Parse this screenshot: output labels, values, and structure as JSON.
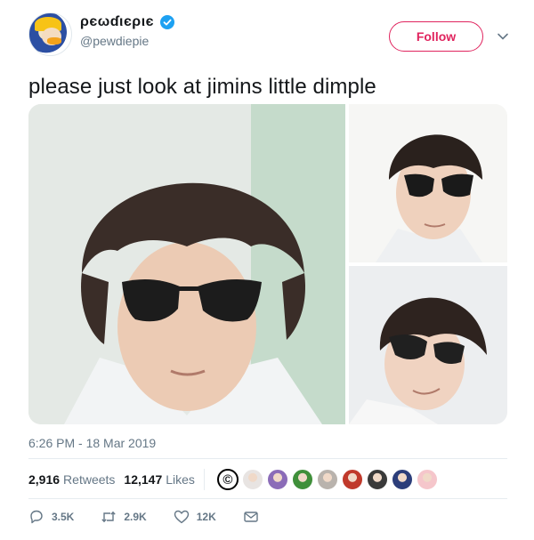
{
  "tweet": {
    "display_name": "ρєωɗιєριє",
    "handle": "@pewdiepie",
    "follow_label": "Follow",
    "text": "please just look at jimins little dimple",
    "timestamp": "6:26 PM - 18 Mar 2019",
    "retweets_count": "2,916",
    "retweets_label": "Retweets",
    "likes_count": "12,147",
    "likes_label": "Likes",
    "reply_count": "3.5K",
    "retweet_action_count": "2.9K",
    "like_action_count": "12K"
  },
  "colors": {
    "accent": "#e0245e",
    "verified": "#1da1f2",
    "secondary_text": "#657786"
  },
  "likers": [
    {
      "name": "copyright-avatar",
      "color": "#000000"
    },
    {
      "name": "liker-avatar-2",
      "color": "#e8e4e2"
    },
    {
      "name": "liker-avatar-3",
      "color": "#8b6cb8"
    },
    {
      "name": "liker-avatar-4",
      "color": "#3f8f3a"
    },
    {
      "name": "liker-avatar-5",
      "color": "#b9b3ad"
    },
    {
      "name": "liker-avatar-6",
      "color": "#c0392b"
    },
    {
      "name": "liker-avatar-7",
      "color": "#3a3a3a"
    },
    {
      "name": "liker-avatar-8",
      "color": "#2c3e7a"
    },
    {
      "name": "liker-avatar-9",
      "color": "#f5c6cb"
    }
  ]
}
